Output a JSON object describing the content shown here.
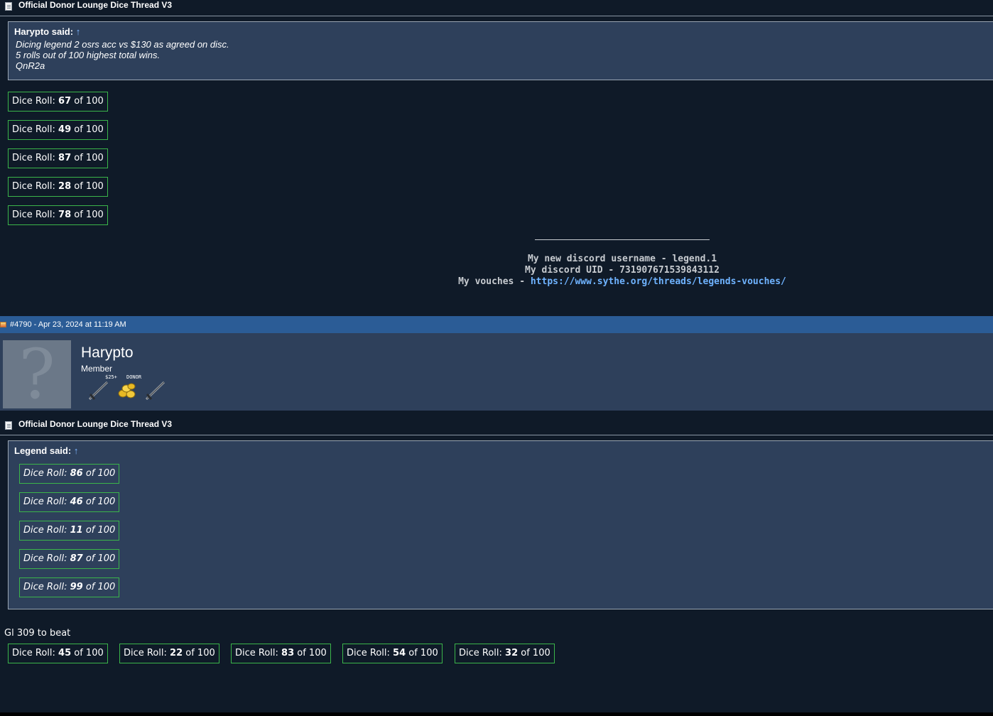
{
  "post1": {
    "thread_title": "Official Donor Lounge Dice Thread V3",
    "quote": {
      "author": "Harypto said:",
      "arrow": "↑",
      "lines": [
        "Dicing legend 2 osrs acc vs $130 as agreed on disc.",
        "5 rolls out of 100 highest total wins.",
        "QnR2a"
      ]
    },
    "rolls": [
      {
        "prefix": "Dice Roll: ",
        "value": "67",
        "suffix": " of 100"
      },
      {
        "prefix": "Dice Roll: ",
        "value": "49",
        "suffix": " of 100"
      },
      {
        "prefix": "Dice Roll: ",
        "value": "87",
        "suffix": " of 100"
      },
      {
        "prefix": "Dice Roll: ",
        "value": "28",
        "suffix": " of 100"
      },
      {
        "prefix": "Dice Roll: ",
        "value": "78",
        "suffix": " of 100"
      }
    ],
    "signature": {
      "line1": "My new discord username - legend.1",
      "line2": "My discord UID - 731907671539843112",
      "line3_prefix": "My vouches - ",
      "line3_link": "https://www.sythe.org/threads/legends-vouches/"
    }
  },
  "post2": {
    "meta": "#4790 - Apr 23, 2024 at 11:19 AM",
    "user": {
      "name": "Harypto",
      "rank": "Member",
      "badges": [
        "$25+",
        "DONOR"
      ],
      "avatar_glyph": "?"
    },
    "thread_title": "Official Donor Lounge Dice Thread V3",
    "quote": {
      "author": "Legend said:",
      "arrow": "↑",
      "rolls": [
        {
          "prefix": "Dice Roll: ",
          "value": "86",
          "suffix": " of 100"
        },
        {
          "prefix": "Dice Roll: ",
          "value": "46",
          "suffix": " of 100"
        },
        {
          "prefix": "Dice Roll: ",
          "value": "11",
          "suffix": " of 100"
        },
        {
          "prefix": "Dice Roll: ",
          "value": "87",
          "suffix": " of 100"
        },
        {
          "prefix": "Dice Roll: ",
          "value": "99",
          "suffix": " of 100"
        }
      ]
    },
    "body": "Gl 309 to beat",
    "rolls": [
      {
        "prefix": "Dice Roll: ",
        "value": "45",
        "suffix": " of 100"
      },
      {
        "prefix": "Dice Roll: ",
        "value": "22",
        "suffix": " of 100"
      },
      {
        "prefix": "Dice Roll: ",
        "value": "83",
        "suffix": " of 100"
      },
      {
        "prefix": "Dice Roll: ",
        "value": "54",
        "suffix": " of 100"
      },
      {
        "prefix": "Dice Roll: ",
        "value": "32",
        "suffix": " of 100"
      }
    ]
  },
  "icons": {
    "thread": "document-icon",
    "post": "post-status-icon",
    "badges": [
      "sword-icon",
      "gold-coins-icon",
      "sword-icon"
    ]
  },
  "colors": {
    "page_bg": "#0f1a28",
    "panel_bg": "#2e405b",
    "post_bar": "#2b5c96",
    "dice_border": "#3bb54a",
    "link": "#6fb3ff"
  }
}
